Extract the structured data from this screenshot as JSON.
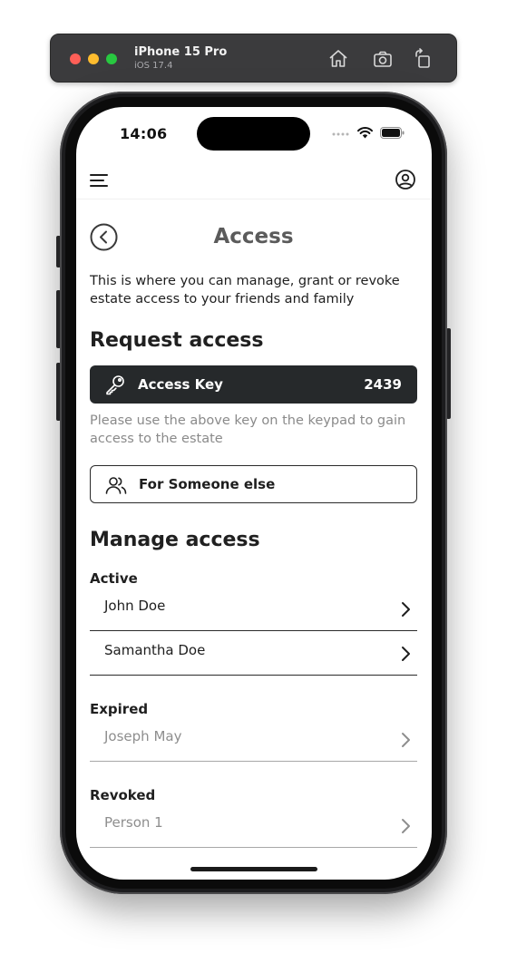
{
  "simulator": {
    "device": "iPhone 15 Pro",
    "os": "iOS 17.4"
  },
  "status_bar": {
    "time": "14:06"
  },
  "page": {
    "title": "Access",
    "intro": "This is where you can manage, grant or revoke estate access to your friends and family"
  },
  "request": {
    "heading": "Request access",
    "key_label": "Access Key",
    "key_code": "2439",
    "help_text": "Please use the above key on the keypad to gain access to the estate",
    "someone_label": "For Someone else"
  },
  "manage": {
    "heading": "Manage access",
    "active_label": "Active",
    "active": [
      "John Doe",
      "Samantha Doe"
    ],
    "expired_label": "Expired",
    "expired": [
      "Joseph May"
    ],
    "revoked_label": "Revoked",
    "revoked": [
      "Person 1"
    ]
  },
  "colors": {
    "accent_dark": "#26292b",
    "muted_text": "#8a8a8a"
  }
}
